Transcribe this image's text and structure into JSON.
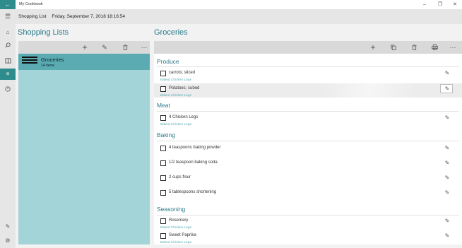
{
  "titlebar": {
    "back_icon": "back-arrow-icon",
    "title": "My Cookbook",
    "minimize": "–",
    "maximize": "❐",
    "close": "✕"
  },
  "commandbar": {
    "section": "Shopping List",
    "datetime": "Friday, September 7, 2018 18:16:54"
  },
  "nav": [
    "home-icon",
    "search-icon",
    "cookbook-icon",
    "shopping-list-icon",
    "timer-icon",
    "edit-icon",
    "settings-icon"
  ],
  "lists_pane": {
    "title": "Shopping Lists",
    "toolbar": [
      "add-icon",
      "edit-icon",
      "delete-icon",
      "more-icon"
    ],
    "items": [
      {
        "name": "Groceries",
        "count": "14 Items"
      }
    ]
  },
  "groceries_pane": {
    "title": "Groceries",
    "toolbar": [
      "add-icon",
      "copy-icon",
      "delete-icon",
      "print-icon",
      "more-icon"
    ],
    "sections": [
      {
        "name": "Produce",
        "items": [
          {
            "text": "carrots; sliced",
            "recipe": "Baked Chicken Legs"
          },
          {
            "text": "Potatoes; cubed",
            "recipe": "Baked Chicken Legs",
            "highlighted": true
          }
        ]
      },
      {
        "name": "Meat",
        "items": [
          {
            "text": "4 Chicken Legs",
            "recipe": "Baked Chicken Legs"
          }
        ]
      },
      {
        "name": "Baking",
        "items": [
          {
            "text": "4 teaspoons baking powder",
            "recipe": ""
          },
          {
            "text": "1/2 teaspoon baking soda",
            "recipe": ""
          },
          {
            "text": "2 cups flour",
            "recipe": ""
          },
          {
            "text": "5 tablespoons shortening",
            "recipe": ""
          }
        ]
      },
      {
        "name": "Seasoning",
        "items": [
          {
            "text": "Rosemary",
            "recipe": "Baked Chicken Legs"
          },
          {
            "text": "Sweet Paprika",
            "recipe": "Baked Chicken Legs"
          }
        ]
      }
    ]
  }
}
